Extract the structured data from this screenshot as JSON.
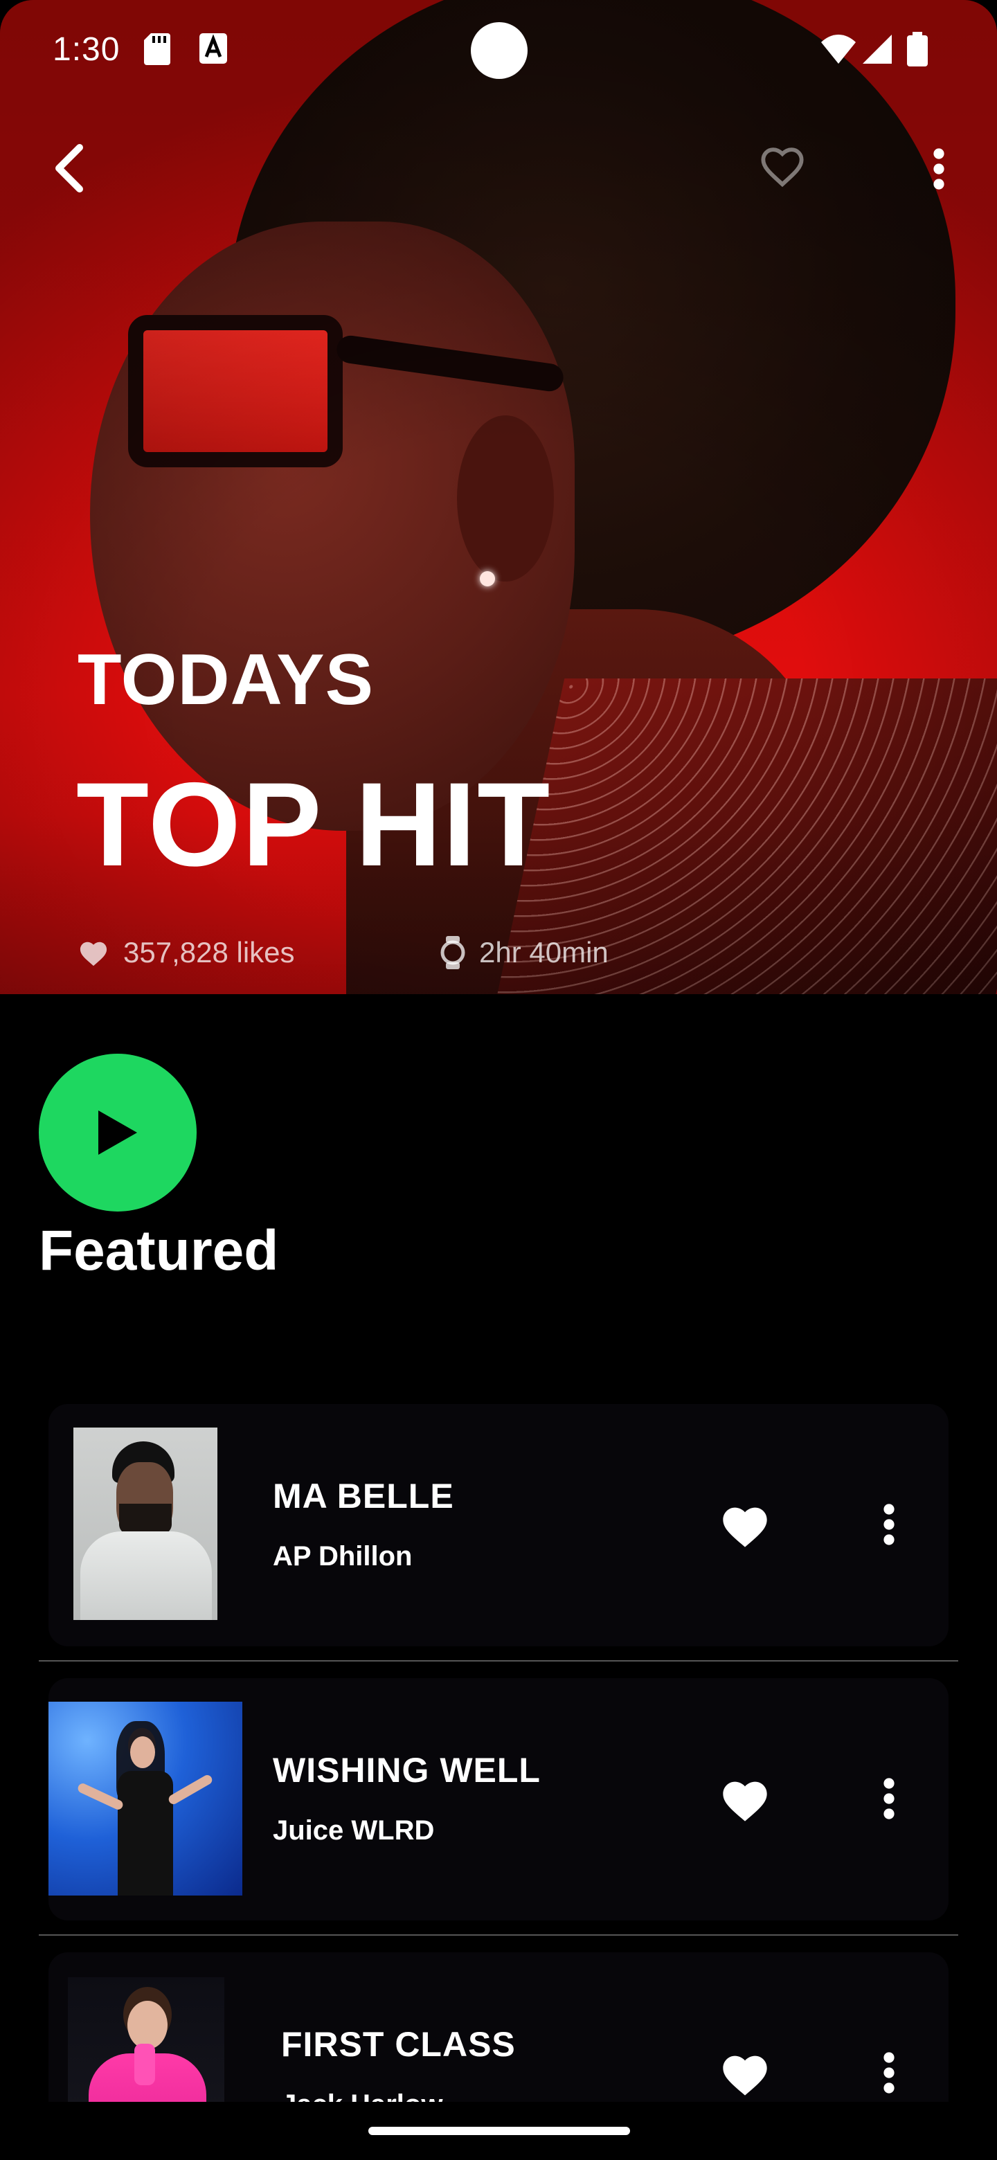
{
  "status_bar": {
    "time": "1:30"
  },
  "hero": {
    "title_line1": "TODAYS",
    "title_line2": "TOP HIT",
    "likes": "357,828 likes",
    "duration": "2hr 40min"
  },
  "section": {
    "title": "Featured"
  },
  "tracks": [
    {
      "title": "MA BELLE",
      "artist": "AP Dhillon"
    },
    {
      "title": "WISHING WELL",
      "artist": "Juice WLRD"
    },
    {
      "title": "FIRST CLASS",
      "artist": "Jack Harlow"
    }
  ],
  "colors": {
    "accent": "#1ed760",
    "hero_red": "#d20c0b",
    "card_bg": "#07060a"
  },
  "icons": {
    "back": "chevron-left-icon",
    "favorite": "heart-outline-icon",
    "menu": "more-vert-icon",
    "play": "play-icon",
    "like": "heart-icon",
    "clock": "watch-icon"
  }
}
